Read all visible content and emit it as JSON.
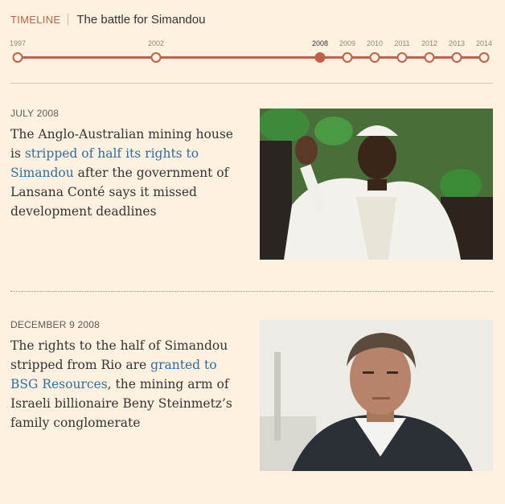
{
  "header": {
    "tag": "TIMELINE",
    "title": "The battle for Simandou"
  },
  "timeline": {
    "years": [
      "1997",
      "2002",
      "2008",
      "2009",
      "2010",
      "2011",
      "2012",
      "2013",
      "2014"
    ],
    "active_year": "2008"
  },
  "entries": [
    {
      "date": "JULY 2008",
      "text_before": "The Anglo-Australian mining house is ",
      "link": "stripped of half its rights to Simandou",
      "text_after": " after the government of Lansana Conté says it missed development deadlines",
      "image": "photo-president-waving"
    },
    {
      "date": "DECEMBER 9 2008",
      "text_before": "The rights to the half of Simandou stripped from Rio are ",
      "link": "granted to BSG Resources",
      "text_after": ", the mining arm of Israeli billionaire Beny Steinmetz’s family conglomerate",
      "image": "photo-businessman-portrait"
    }
  ],
  "colors": {
    "background": "#fff1e0",
    "accent": "#c0614b",
    "link": "#2e6e9e",
    "text": "#333333"
  }
}
